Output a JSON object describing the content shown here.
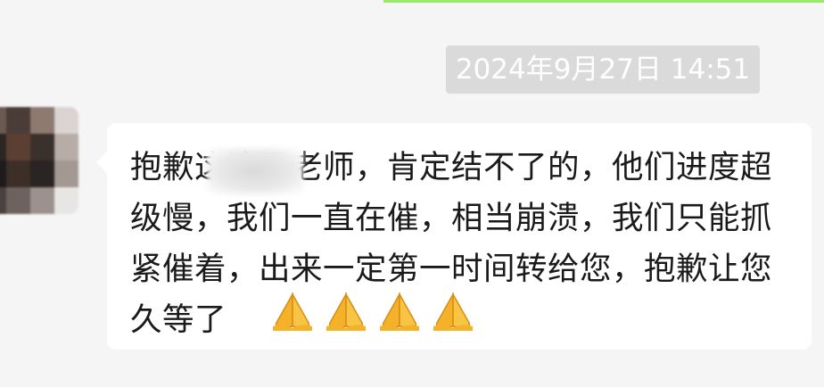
{
  "timestamp": "2024年9月27日 14:51",
  "message": {
    "text": "抱歉这边周老师，肯定结不了的，他们进度超级慢，我们一直在催，相当崩溃，我们只能抓紧催着，出来一定第一时间转给您，抱歉让您久等了",
    "emoji": [
      "pray-icon",
      "pray-icon",
      "pray-icon",
      "pray-icon"
    ]
  },
  "colors": {
    "background": "#f5f5f5",
    "bubble": "#ffffff",
    "timestamp_bg": "#dadada",
    "own_bubble_edge": "#95ec69",
    "emoji": "#f4b22a"
  }
}
